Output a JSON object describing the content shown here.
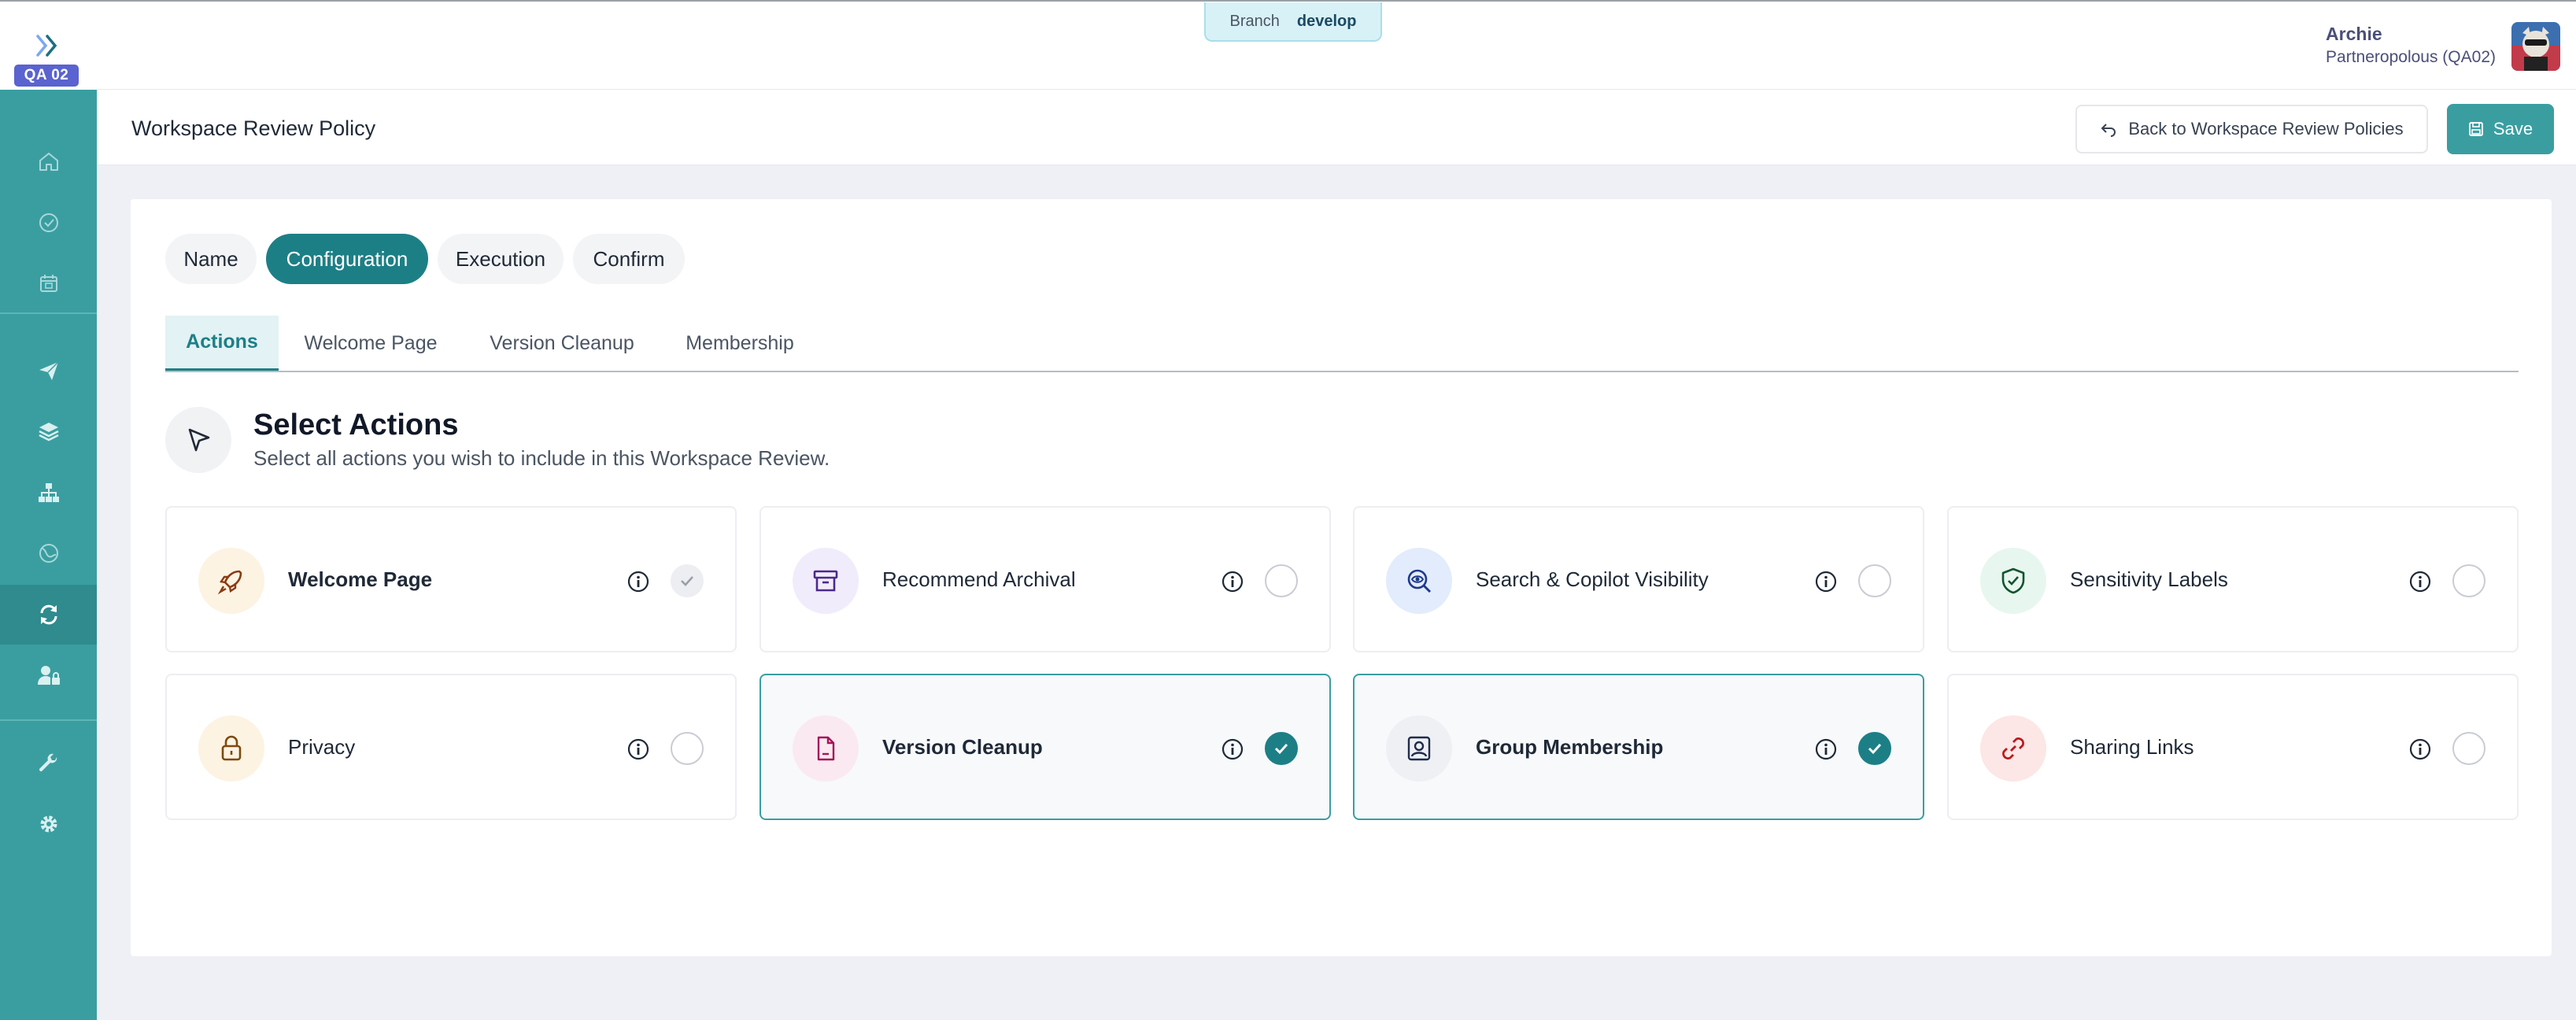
{
  "app": {
    "env_badge": "QA 02",
    "branch_label": "Branch",
    "branch_value": "develop"
  },
  "user": {
    "name": "Archie",
    "org": "Partneropolous (QA02)"
  },
  "sidebar": {
    "items": [
      {
        "icon": "home-icon",
        "active": false
      },
      {
        "icon": "check-circle-icon",
        "active": false
      },
      {
        "icon": "calendar-icon",
        "active": false
      },
      {
        "icon": "send-icon",
        "active": false
      },
      {
        "icon": "layers-icon",
        "active": false
      },
      {
        "icon": "hierarchy-icon",
        "active": false
      },
      {
        "icon": "globe-icon",
        "active": false
      },
      {
        "icon": "sync-icon",
        "active": true
      },
      {
        "icon": "user-lock-icon",
        "active": false
      },
      {
        "icon": "wrench-icon",
        "active": false
      },
      {
        "icon": "gear-icon",
        "active": false
      }
    ]
  },
  "page": {
    "title": "Workspace Review Policy",
    "back_label": "Back to Workspace Review Policies",
    "save_label": "Save"
  },
  "steps": [
    {
      "label": "Name",
      "active": false
    },
    {
      "label": "Configuration",
      "active": true
    },
    {
      "label": "Execution",
      "active": false
    },
    {
      "label": "Confirm",
      "active": false
    }
  ],
  "subtabs": [
    {
      "label": "Actions",
      "active": true
    },
    {
      "label": "Welcome Page",
      "active": false
    },
    {
      "label": "Version Cleanup",
      "active": false
    },
    {
      "label": "Membership",
      "active": false
    }
  ],
  "section": {
    "title": "Select Actions",
    "subtitle": "Select all actions you wish to include in this Workspace Review."
  },
  "actions": [
    {
      "label": "Welcome Page",
      "icon": "rocket-icon",
      "state": "locked",
      "icon_bg": "#fdf3e3",
      "icon_color": "#8a3b12"
    },
    {
      "label": "Recommend Archival",
      "icon": "archive-icon",
      "state": "off",
      "icon_bg": "#f1ecfb",
      "icon_color": "#4b2a8a"
    },
    {
      "label": "Search & Copilot Visibility",
      "icon": "search-eye-icon",
      "state": "off",
      "icon_bg": "#e3ecfc",
      "icon_color": "#1e3a8a"
    },
    {
      "label": "Sensitivity Labels",
      "icon": "shield-check-icon",
      "state": "off",
      "icon_bg": "#e7f7ef",
      "icon_color": "#14532d"
    },
    {
      "label": "Privacy",
      "icon": "lock-icon",
      "state": "off",
      "icon_bg": "#fdf3e3",
      "icon_color": "#7c4a0e"
    },
    {
      "label": "Version Cleanup",
      "icon": "file-icon",
      "state": "on",
      "icon_bg": "#fbe9f1",
      "icon_color": "#a3155a"
    },
    {
      "label": "Group Membership",
      "icon": "user-square-icon",
      "state": "on",
      "icon_bg": "#eef0f4",
      "icon_color": "#1f2d4a"
    },
    {
      "label": "Sharing Links",
      "icon": "link-icon",
      "state": "off",
      "icon_bg": "#fde6e6",
      "icon_color": "#b91c1c"
    }
  ]
}
